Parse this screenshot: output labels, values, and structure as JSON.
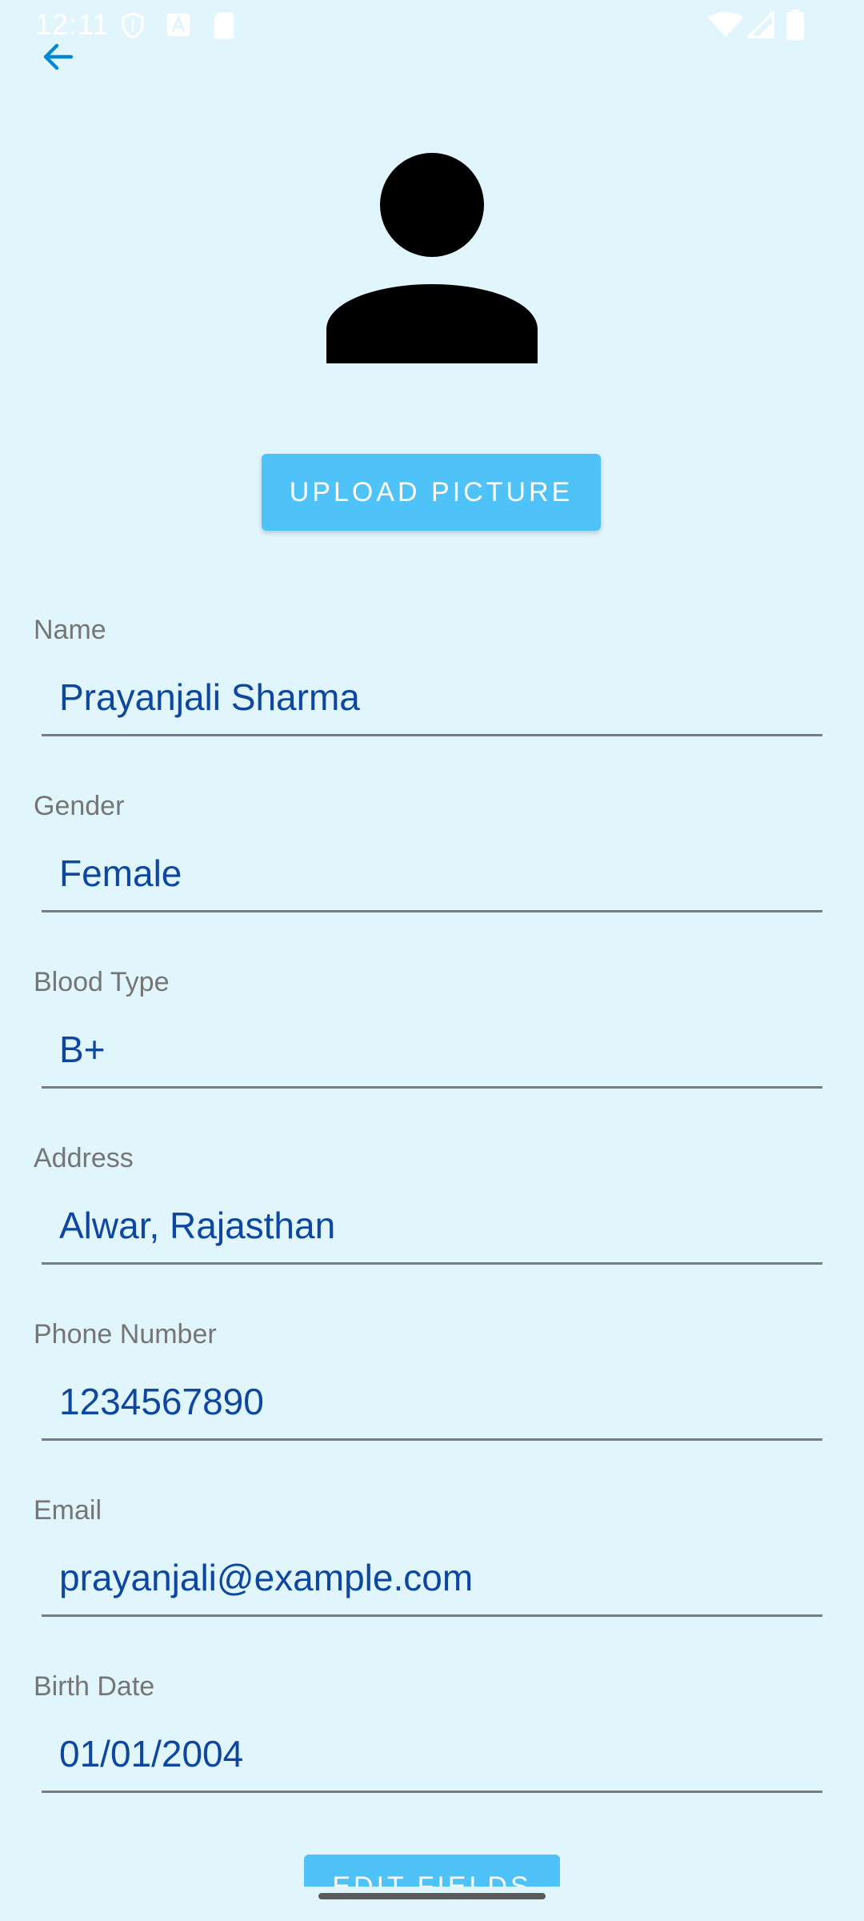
{
  "status_bar": {
    "time": "12:11",
    "icons": [
      "shield-icon",
      "font-icon",
      "sd-card-icon",
      "wifi-icon",
      "signal-icon",
      "battery-icon"
    ]
  },
  "header": {
    "back_icon": "arrow-left-icon"
  },
  "avatar": {
    "icon": "person-icon"
  },
  "upload_button": {
    "label": "UPLOAD PICTURE"
  },
  "fields": {
    "name": {
      "label": "Name",
      "value": "Prayanjali Sharma"
    },
    "gender": {
      "label": "Gender",
      "value": "Female"
    },
    "blood_type": {
      "label": "Blood Type",
      "value": "B+"
    },
    "address": {
      "label": "Address",
      "value": "Alwar, Rajasthan"
    },
    "phone": {
      "label": "Phone Number",
      "value": "1234567890"
    },
    "email": {
      "label": "Email",
      "value": "prayanjali@example.com"
    },
    "birth_date": {
      "label": "Birth Date",
      "value": "01/01/2004"
    }
  },
  "edit_button": {
    "label": "EDIT FIELDS"
  },
  "colors": {
    "background": "#e1f5fc",
    "accent": "#4fc3f7",
    "value_text": "#0d47a1",
    "back_arrow": "#0288d1",
    "label_text": "#757575"
  }
}
